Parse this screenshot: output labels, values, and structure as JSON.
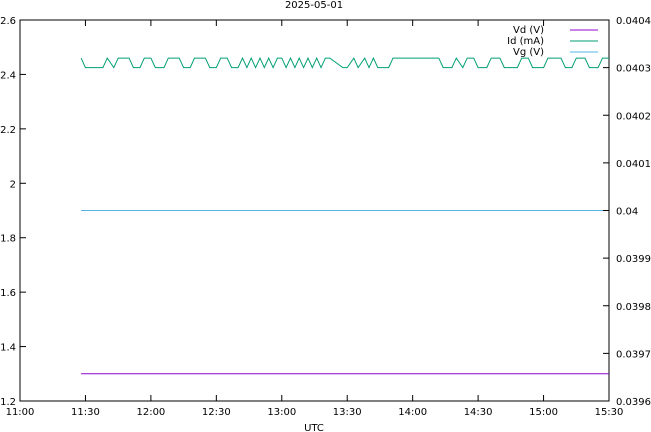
{
  "chart_data": {
    "type": "line",
    "title": "2025-05-01",
    "xlabel": "UTC",
    "ylabel_left": "",
    "ylabel_right": "",
    "x_ticks": [
      "11:00",
      "11:30",
      "12:00",
      "12:30",
      "13:00",
      "13:30",
      "14:00",
      "14:30",
      "15:00",
      "15:30"
    ],
    "x_range": [
      "11:00",
      "15:30"
    ],
    "y_left_ticks": [
      "1.2",
      "1.4",
      "1.6",
      "1.8",
      "2",
      "2.2",
      "2.4",
      "2.6"
    ],
    "y_left_range": [
      1.2,
      2.6
    ],
    "y_right_ticks": [
      "0.0396",
      "0.0397",
      "0.0398",
      "0.0399",
      "0.04",
      "0.0401",
      "0.0402",
      "0.0403",
      "0.0404"
    ],
    "y_right_range": [
      0.0396,
      0.0404
    ],
    "grid": false,
    "legend_position": "top-right",
    "series": [
      {
        "name": "Vd (V)",
        "axis": "left",
        "color": "#9400d3",
        "x": [
          "11:28",
          "15:30"
        ],
        "values": [
          1.3,
          1.3
        ]
      },
      {
        "name": "Id (mA)",
        "axis": "right",
        "color": "#009e73",
        "x": [
          "11:28",
          "11:30",
          "11:38",
          "11:40",
          "11:43",
          "11:45",
          "11:50",
          "11:52",
          "11:55",
          "11:57",
          "12:00",
          "12:02",
          "12:06",
          "12:08",
          "12:13",
          "12:15",
          "12:18",
          "12:20",
          "12:25",
          "12:27",
          "12:30",
          "12:32",
          "12:35",
          "12:37",
          "12:40",
          "12:42",
          "12:44",
          "12:46",
          "12:48",
          "12:50",
          "12:52",
          "12:54",
          "12:56",
          "12:58",
          "13:00",
          "13:02",
          "13:04",
          "13:06",
          "13:08",
          "13:10",
          "13:12",
          "13:14",
          "13:16",
          "13:18",
          "13:20",
          "13:22",
          "13:28",
          "13:30",
          "13:33",
          "13:35",
          "13:38",
          "13:40",
          "13:42",
          "13:44",
          "13:49",
          "13:51",
          "14:12",
          "14:14",
          "14:18",
          "14:20",
          "14:23",
          "14:25",
          "14:28",
          "14:30",
          "14:34",
          "14:36",
          "14:40",
          "14:42",
          "14:48",
          "14:50",
          "14:53",
          "14:55",
          "15:00",
          "15:02",
          "15:08",
          "15:10",
          "15:13",
          "15:15",
          "15:19",
          "15:21",
          "15:25",
          "15:27",
          "15:30"
        ],
        "values": [
          0.04032,
          0.0403,
          0.0403,
          0.04032,
          0.0403,
          0.04032,
          0.04032,
          0.0403,
          0.0403,
          0.04032,
          0.04032,
          0.0403,
          0.0403,
          0.04032,
          0.04032,
          0.0403,
          0.0403,
          0.04032,
          0.04032,
          0.0403,
          0.0403,
          0.04032,
          0.04032,
          0.0403,
          0.0403,
          0.04032,
          0.0403,
          0.04032,
          0.0403,
          0.04032,
          0.0403,
          0.04032,
          0.0403,
          0.04032,
          0.04032,
          0.0403,
          0.04032,
          0.0403,
          0.04032,
          0.0403,
          0.04032,
          0.0403,
          0.04032,
          0.0403,
          0.04032,
          0.04032,
          0.0403,
          0.0403,
          0.04032,
          0.0403,
          0.04032,
          0.0403,
          0.04032,
          0.0403,
          0.0403,
          0.04032,
          0.04032,
          0.0403,
          0.0403,
          0.04032,
          0.0403,
          0.04032,
          0.04032,
          0.0403,
          0.0403,
          0.04032,
          0.04032,
          0.0403,
          0.0403,
          0.04032,
          0.04032,
          0.0403,
          0.0403,
          0.04032,
          0.04032,
          0.0403,
          0.0403,
          0.04032,
          0.04032,
          0.0403,
          0.0403,
          0.04032,
          0.04032
        ]
      },
      {
        "name": "Vg (V)",
        "axis": "right",
        "color": "#56b4e9",
        "x": [
          "11:28",
          "15:30"
        ],
        "values": [
          0.04,
          0.04
        ]
      }
    ]
  }
}
